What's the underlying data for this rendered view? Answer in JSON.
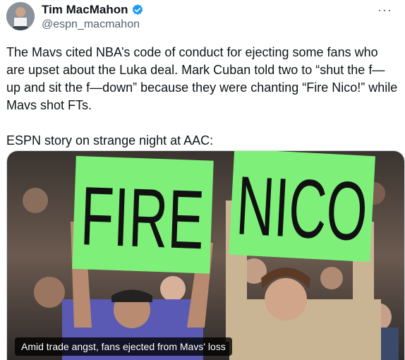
{
  "author": {
    "name": "Tim MacMahon",
    "handle": "@espn_macmahon",
    "verified": true
  },
  "more_label": "···",
  "tweet": {
    "text": "The Mavs cited NBA’s code of conduct for ejecting some fans who are upset about the Luka deal. Mark Cuban told two to “shut the f— up and sit the f—down” because they were chanting “Fire Nico!” while Mavs shot FTs.\n\nESPN story on strange night at AAC:"
  },
  "media": {
    "sign_left": "FIRE",
    "sign_right": "NICO",
    "caption": "Amid trade angst, fans ejected from Mavs' loss"
  },
  "colors": {
    "verified_blue": "#1d9bf0",
    "sign_green": "#7ef07a"
  }
}
